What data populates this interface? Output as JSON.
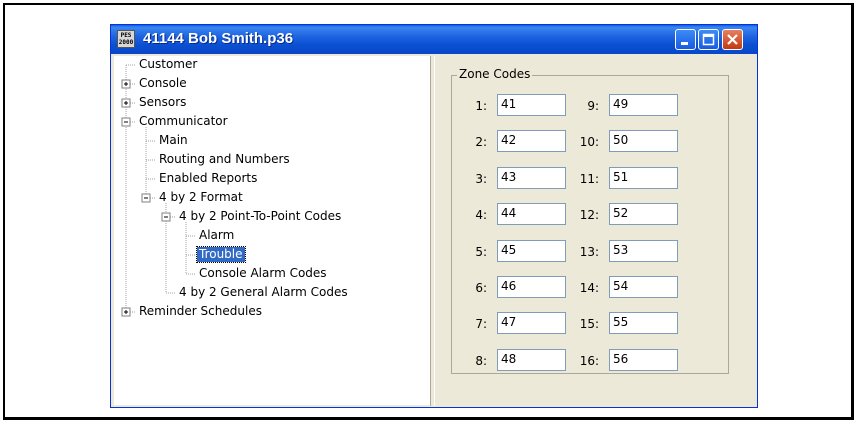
{
  "window": {
    "title": "41144 Bob Smith.p36",
    "icon_text": "PES 2000",
    "controls": [
      "minimize",
      "maximize",
      "close"
    ]
  },
  "tree": {
    "items": [
      {
        "label": "Customer",
        "level": 0,
        "expander": "none"
      },
      {
        "label": "Console",
        "level": 0,
        "expander": "plus"
      },
      {
        "label": "Sensors",
        "level": 0,
        "expander": "plus"
      },
      {
        "label": "Communicator",
        "level": 0,
        "expander": "minus"
      },
      {
        "label": "Main",
        "level": 1,
        "expander": "none"
      },
      {
        "label": "Routing and Numbers",
        "level": 1,
        "expander": "none"
      },
      {
        "label": "Enabled Reports",
        "level": 1,
        "expander": "none"
      },
      {
        "label": "4 by 2 Format",
        "level": 1,
        "expander": "minus"
      },
      {
        "label": "4 by 2 Point-To-Point Codes",
        "level": 2,
        "expander": "minus"
      },
      {
        "label": "Alarm",
        "level": 3,
        "expander": "none"
      },
      {
        "label": "Trouble",
        "level": 3,
        "expander": "none",
        "selected": true
      },
      {
        "label": "Console Alarm Codes",
        "level": 3,
        "expander": "none"
      },
      {
        "label": "4 by 2 General Alarm Codes",
        "level": 2,
        "expander": "none"
      },
      {
        "label": "Reminder Schedules",
        "level": 0,
        "expander": "plus"
      }
    ]
  },
  "zone_codes": {
    "title": "Zone Codes",
    "left": [
      {
        "label": "1:",
        "value": "41"
      },
      {
        "label": "2:",
        "value": "42"
      },
      {
        "label": "3:",
        "value": "43"
      },
      {
        "label": "4:",
        "value": "44"
      },
      {
        "label": "5:",
        "value": "45"
      },
      {
        "label": "6:",
        "value": "46"
      },
      {
        "label": "7:",
        "value": "47"
      },
      {
        "label": "8:",
        "value": "48"
      }
    ],
    "right": [
      {
        "label": "9:",
        "value": "49"
      },
      {
        "label": "10:",
        "value": "50"
      },
      {
        "label": "11:",
        "value": "51"
      },
      {
        "label": "12:",
        "value": "52"
      },
      {
        "label": "13:",
        "value": "53"
      },
      {
        "label": "14:",
        "value": "54"
      },
      {
        "label": "15:",
        "value": "55"
      },
      {
        "label": "16:",
        "value": "56"
      }
    ]
  },
  "colors": {
    "titlebar": "#0a4fd2",
    "selection": "#316ac5",
    "dialog_bg": "#ece9d8"
  }
}
